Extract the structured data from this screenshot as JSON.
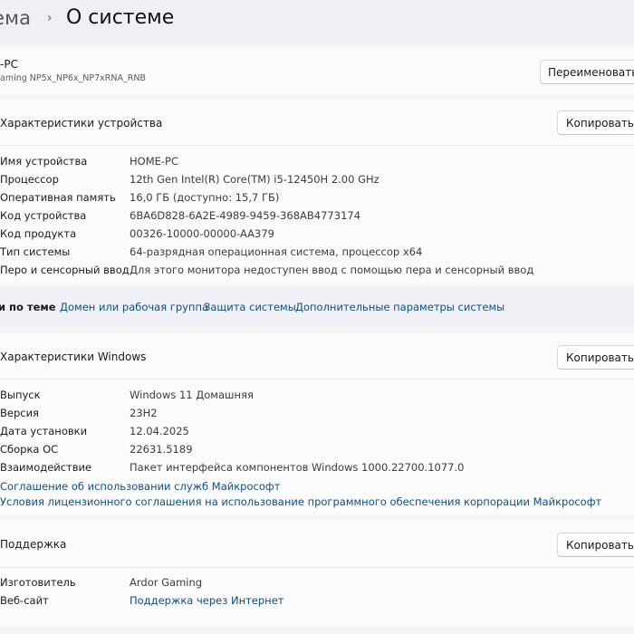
{
  "breadcrumb": {
    "parent": "ема",
    "separator": "›",
    "current": "О системе"
  },
  "device_header": {
    "name": "-PC",
    "model": "aming NP5x_NP6x_NP7xRNA_RNB",
    "rename_button": "Переименовать эт"
  },
  "device_specs": {
    "title": "Характеристики устройства",
    "copy_button": "Копировать",
    "rows": [
      {
        "label": "Имя устройства",
        "value": "HOME-PC"
      },
      {
        "label": "Процессор",
        "value": "12th Gen Intel(R) Core(TM) i5-12450H   2.00 GHz"
      },
      {
        "label": "Оперативная память",
        "value": "16,0 ГБ (доступно: 15,7 ГБ)"
      },
      {
        "label": "Код устройства",
        "value": "6BA6D828-6A2E-4989-9459-368AB4773174"
      },
      {
        "label": "Код продукта",
        "value": "00326-10000-00000-AA379"
      },
      {
        "label": "Тип системы",
        "value": "64-разрядная операционная система, процессор x64"
      },
      {
        "label": "Перо и сенсорный ввод",
        "value": "Для этого монитора недоступен ввод с помощью пера и сенсорный ввод"
      }
    ]
  },
  "related": {
    "label": "и по теме",
    "links": [
      "Домен или рабочая группа",
      "Защита системы",
      "Дополнительные параметры системы"
    ]
  },
  "windows_specs": {
    "title": "Характеристики Windows",
    "copy_button": "Копировать",
    "rows": [
      {
        "label": "Выпуск",
        "value": "Windows 11 Домашняя"
      },
      {
        "label": "Версия",
        "value": "23H2"
      },
      {
        "label": "Дата установки",
        "value": "12.04.2025"
      },
      {
        "label": "Сборка ОС",
        "value": "22631.5189"
      },
      {
        "label": "Взаимодействие",
        "value": "Пакет интерфейса компонентов Windows 1000.22700.1077.0"
      }
    ],
    "links": [
      "Соглашение об использовании служб Майкрософт",
      "Условия лицензионного соглашения на использование программного обеспечения корпорации Майкрософт"
    ]
  },
  "support": {
    "title": "Поддержка",
    "copy_button": "Копировать",
    "rows": [
      {
        "label": "Изготовитель",
        "value": "Ardor Gaming"
      },
      {
        "label": "Веб-сайт",
        "value": "Поддержка через Интернет"
      }
    ]
  }
}
